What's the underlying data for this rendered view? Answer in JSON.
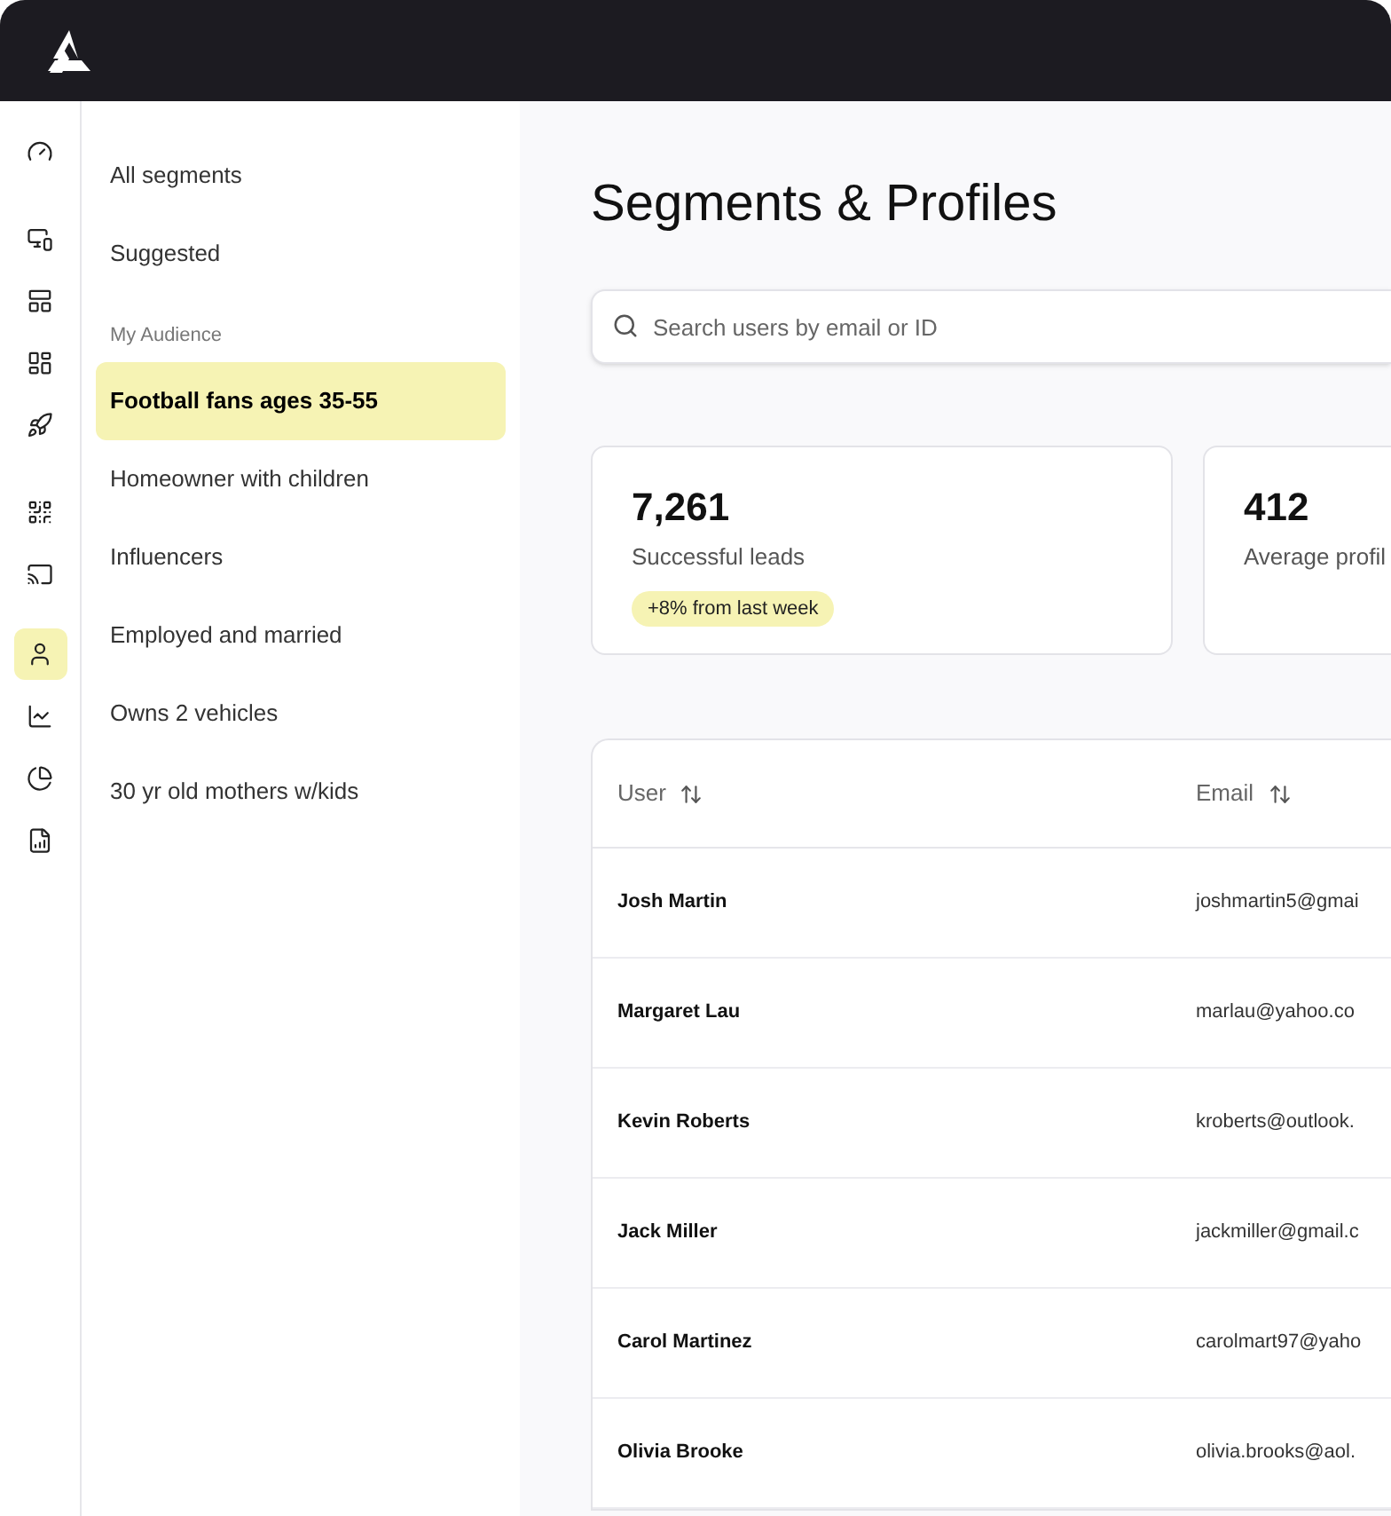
{
  "rail": [
    {
      "selected": false
    },
    {
      "selected": false
    },
    {
      "selected": false
    },
    {
      "selected": false
    },
    {
      "selected": false
    },
    {
      "selected": false
    },
    {
      "selected": false
    },
    {
      "selected": true
    },
    {
      "selected": false
    },
    {
      "selected": false
    },
    {
      "selected": false
    }
  ],
  "segments": {
    "top": [
      {
        "label": "All segments",
        "selected": false
      },
      {
        "label": "Suggested",
        "selected": false
      }
    ],
    "section_title": "My Audience",
    "items": [
      {
        "label": "Football fans ages 35-55",
        "selected": true
      },
      {
        "label": "Homeowner with children",
        "selected": false
      },
      {
        "label": "Influencers",
        "selected": false
      },
      {
        "label": "Employed and married",
        "selected": false
      },
      {
        "label": "Owns 2 vehicles",
        "selected": false
      },
      {
        "label": "30 yr old mothers w/kids",
        "selected": false
      }
    ]
  },
  "title": "Segments & Profiles",
  "search": {
    "placeholder": "Search users by email or ID"
  },
  "stats": [
    {
      "value": "7,261",
      "label": "Successful leads",
      "badge": "+8% from last week"
    },
    {
      "value": "412",
      "label": "Average profil"
    }
  ],
  "table": {
    "columns": [
      "User",
      "Email"
    ],
    "rows": [
      [
        "Josh Martin",
        "joshmartin5@gmai"
      ],
      [
        "Margaret Lau",
        "marlau@yahoo.co"
      ],
      [
        "Kevin Roberts",
        "kroberts@outlook."
      ],
      [
        "Jack Miller",
        "jackmiller@gmail.c"
      ],
      [
        "Carol Martinez",
        "carolmart97@yaho"
      ],
      [
        "Olivia Brooke",
        "olivia.brooks@aol."
      ]
    ]
  }
}
